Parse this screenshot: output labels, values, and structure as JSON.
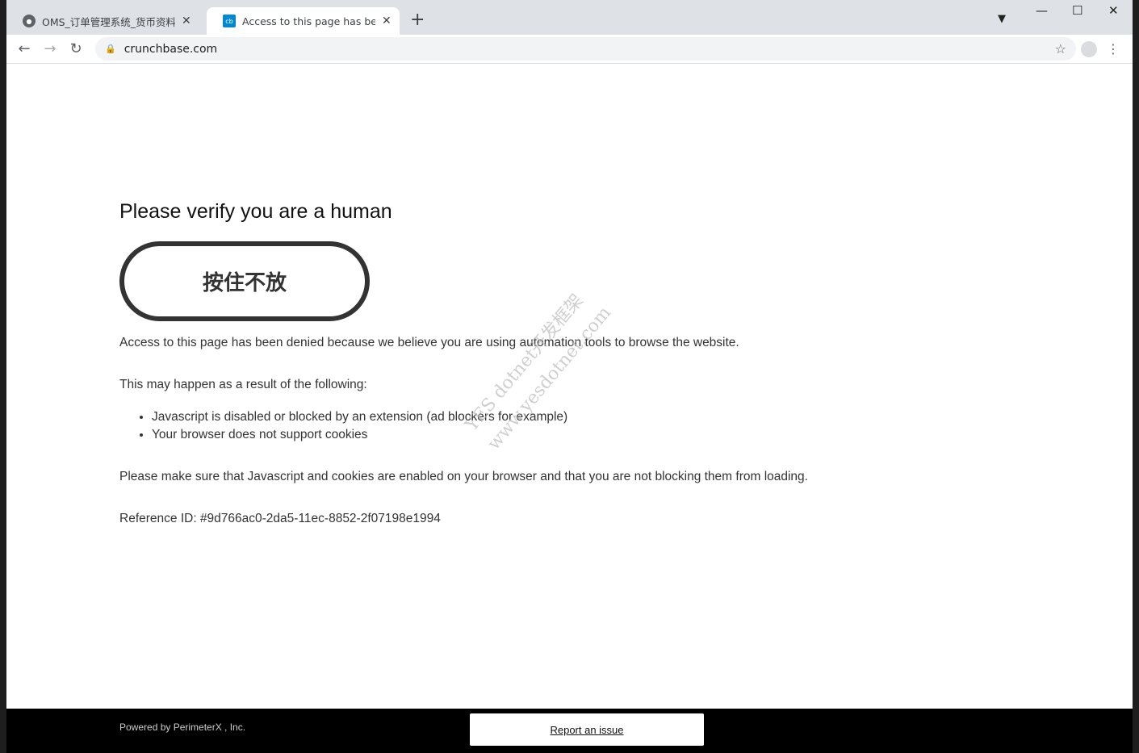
{
  "browser": {
    "tabs": [
      {
        "title": "OMS_订单管理系统_货币资料 - 货",
        "icon": "globe-icon",
        "active": false
      },
      {
        "title": "Access to this page has been denied",
        "icon": "cb",
        "active": true
      }
    ],
    "url": "crunchbase.com",
    "accent": "#0288d1"
  },
  "page": {
    "heading": "Please verify you are a human",
    "hold_button": "按住不放",
    "intro": "Access to this page has been denied because we believe you are using automation tools to browse the website.",
    "reasons_intro": "This may happen as a result of the following:",
    "reasons": [
      "Javascript is disabled or blocked by an extension (ad blockers for example)",
      "Your browser does not support cookies"
    ],
    "instructions": "Please make sure that Javascript and cookies are enabled on your browser and that you are not blocking them from loading.",
    "reference": "Reference ID: #9d766ac0-2da5-11ec-8852-2f07198e1994"
  },
  "watermark": [
    "YES dotnet开发框架",
    "www.yesdotnet.com"
  ],
  "footer": {
    "powered": "Powered by PerimeterX , Inc.",
    "report": "Report an issue"
  }
}
